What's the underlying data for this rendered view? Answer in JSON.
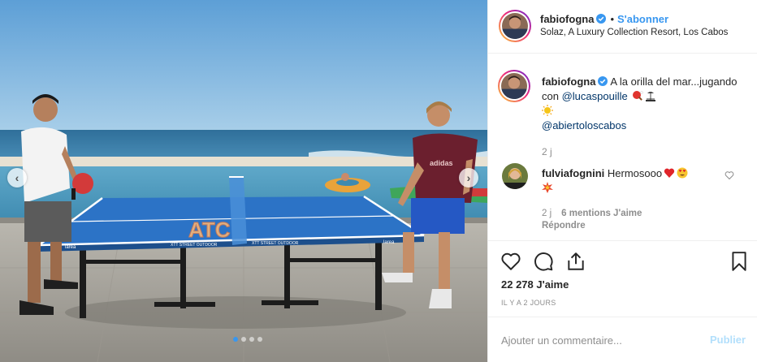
{
  "photo": {
    "alt_image": "photo",
    "table_brand_left": "larea",
    "table_brand_right": "larea",
    "table_model_left": "XTT STREET OUTDOOR",
    "table_model_right": "XTT STREET OUTDOOR",
    "shirt_logo": "adidas",
    "dots_total": 4,
    "dot_active_index": 0
  },
  "header": {
    "username": "fabiofogna",
    "separator": "•",
    "follow_label": "S'abonner",
    "location": "Solaz, A Luxury Collection Resort, Los Cabos"
  },
  "caption": {
    "username": "fabiofogna",
    "text_part1": "A la orilla del mar...jugando con",
    "mention1": "@lucaspouille",
    "mention2": "@abiertoloscabos",
    "time": "2 j"
  },
  "comment": {
    "username": "fulviafognini",
    "text": "Hermosooo",
    "time": "2 j",
    "likes": "6 mentions J'aime",
    "reply_label": "Répondre"
  },
  "actions": {
    "likes_count": "22 278 J'aime",
    "date": "IL Y A 2 JOURS"
  },
  "comment_box": {
    "placeholder": "Ajouter un commentaire...",
    "publish_label": "Publier"
  },
  "colors": {
    "accent": "#3897f0",
    "mention": "#003569",
    "muted": "#8e8e8e",
    "publish_disabled": "#b2dffc"
  }
}
